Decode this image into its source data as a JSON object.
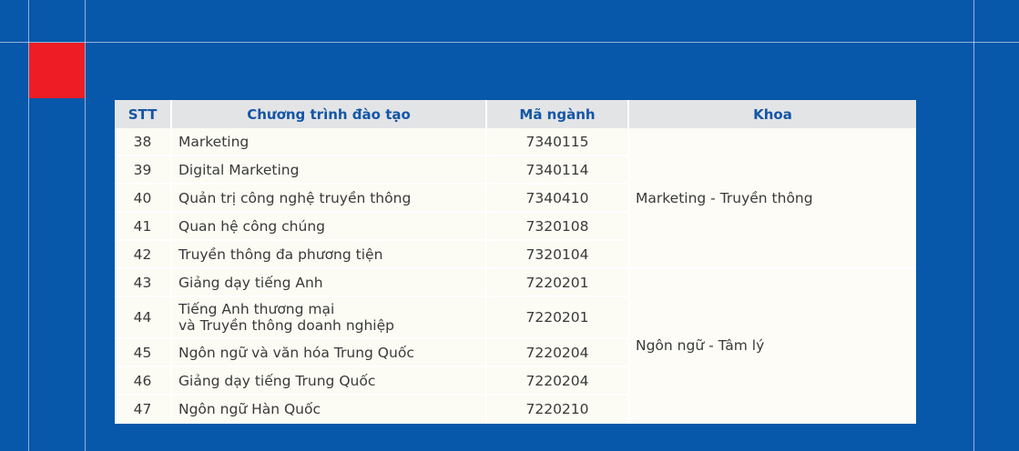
{
  "table": {
    "headers": {
      "stt": "STT",
      "program": "Chương trình đào tạo",
      "code": "Mã ngành",
      "faculty": "Khoa"
    },
    "faculties": {
      "marketing": "Marketing - Truyền thông",
      "language": "Ngôn ngữ - Tâm lý"
    },
    "rows": [
      {
        "stt": "38",
        "program": "Marketing",
        "code": "7340115"
      },
      {
        "stt": "39",
        "program": "Digital Marketing",
        "code": "7340114"
      },
      {
        "stt": "40",
        "program": "Quản trị công nghệ truyền thông",
        "code": "7340410"
      },
      {
        "stt": "41",
        "program": "Quan hệ công chúng",
        "code": "7320108"
      },
      {
        "stt": "42",
        "program": "Truyền thông đa phương tiện",
        "code": "7320104"
      },
      {
        "stt": "43",
        "program": "Giảng dạy tiếng Anh",
        "code": "7220201"
      },
      {
        "stt": "44",
        "program": "Tiếng Anh thương mại",
        "program_line2": "và Truyền thông doanh nghiệp",
        "code": "7220201"
      },
      {
        "stt": "45",
        "program": "Ngôn ngữ và văn hóa Trung Quốc",
        "code": "7220204"
      },
      {
        "stt": "46",
        "program": "Giảng dạy tiếng Trung Quốc",
        "code": "7220204"
      },
      {
        "stt": "47",
        "program": "Ngôn ngữ Hàn Quốc",
        "code": "7220210"
      }
    ]
  },
  "colors": {
    "background": "#0757aa",
    "accent_red": "#ee1c25",
    "header_text": "#1456a6",
    "header_bg": "#e3e4e6",
    "cell_bg": "#fcfbf4"
  }
}
